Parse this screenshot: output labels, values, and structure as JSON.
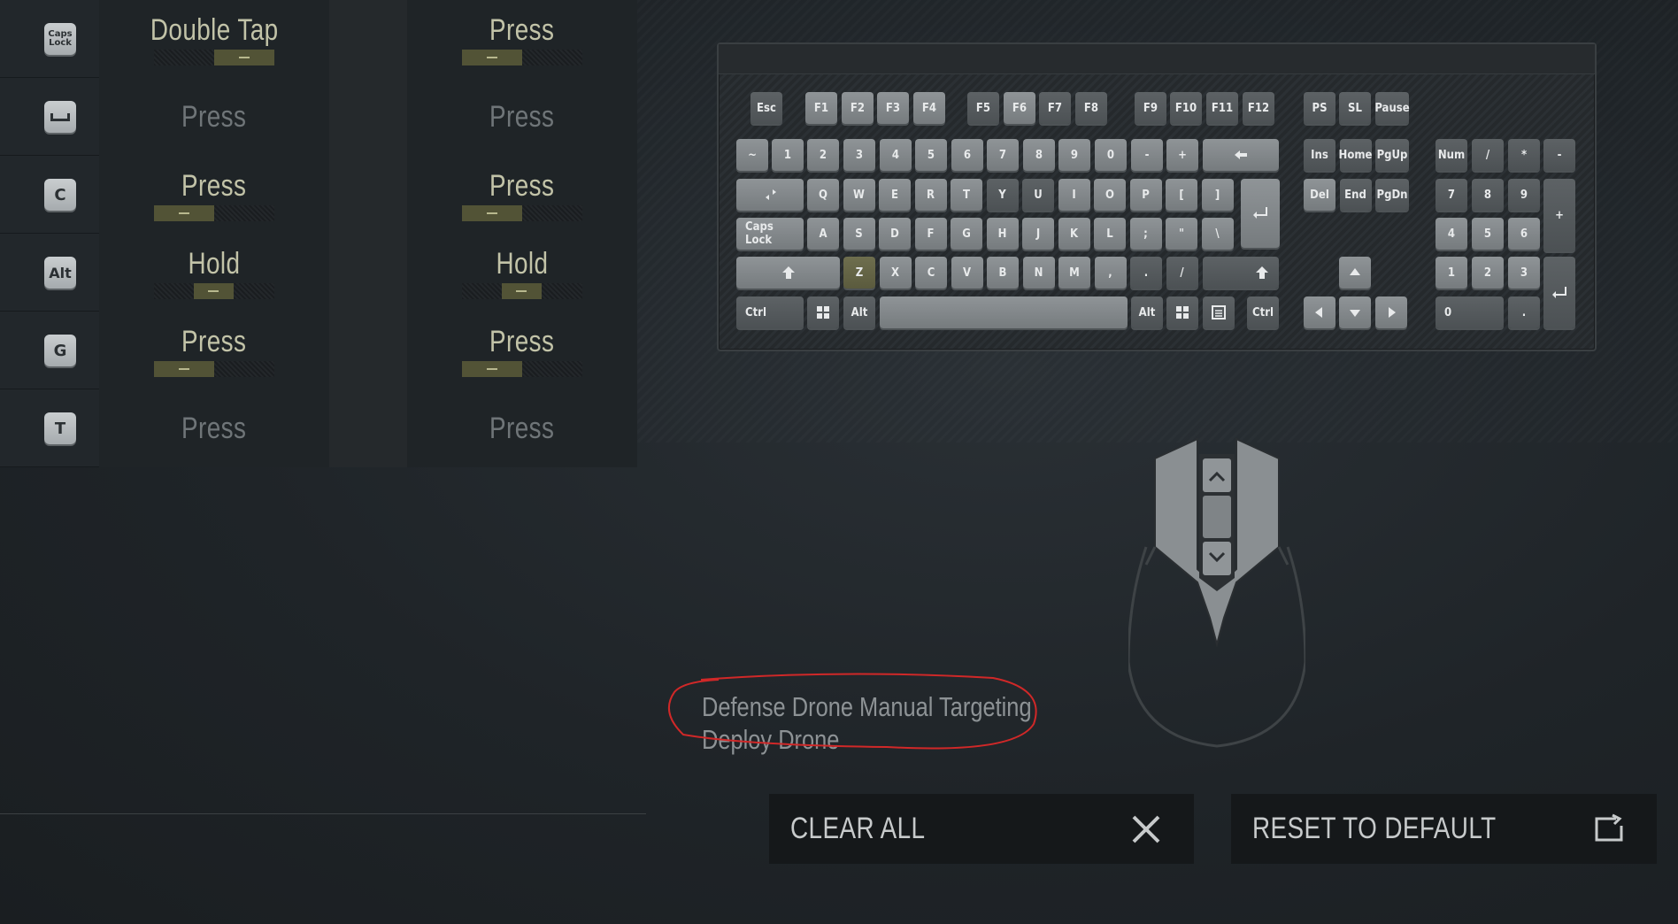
{
  "bindings": [
    {
      "key": "Caps Lock",
      "key_icon": "caps-lock-key",
      "primary": "Double Tap",
      "primary_active": true,
      "primary_fill": 0.5,
      "secondary": "Press",
      "secondary_active": true,
      "secondary_fill": 0.5
    },
    {
      "key": "",
      "key_icon": "spacebar-key",
      "primary": "Press",
      "primary_active": false,
      "secondary": "Press",
      "secondary_active": false
    },
    {
      "key": "C",
      "key_icon": "c-key",
      "primary": "Press",
      "primary_active": true,
      "primary_fill": 0.5,
      "secondary": "Press",
      "secondary_active": true,
      "secondary_fill": 0.5
    },
    {
      "key": "Alt",
      "key_icon": "alt-key",
      "primary": "Hold",
      "primary_active": true,
      "primary_fill": 0.33,
      "secondary": "Hold",
      "secondary_active": true,
      "secondary_fill": 0.33
    },
    {
      "key": "G",
      "key_icon": "g-key",
      "primary": "Press",
      "primary_active": true,
      "primary_fill": 0.5,
      "secondary": "Press",
      "secondary_active": true,
      "secondary_fill": 0.5
    },
    {
      "key": "T",
      "key_icon": "t-key",
      "primary": "Press",
      "primary_active": false,
      "secondary": "Press",
      "secondary_active": false
    }
  ],
  "keyboard": {
    "fn_row": [
      "Esc",
      "F1",
      "F2",
      "F3",
      "F4",
      "F5",
      "F6",
      "F7",
      "F8",
      "F9",
      "F10",
      "F11",
      "F12",
      "PS",
      "SL",
      "Pause"
    ],
    "num_row": [
      "~",
      "1",
      "2",
      "3",
      "4",
      "5",
      "6",
      "7",
      "8",
      "9",
      "0",
      "-",
      "+"
    ],
    "q_row": [
      "Q",
      "W",
      "E",
      "R",
      "T",
      "Y",
      "U",
      "I",
      "O",
      "P",
      "[",
      "]"
    ],
    "a_row": [
      "Caps Lock",
      "A",
      "S",
      "D",
      "F",
      "G",
      "H",
      "J",
      "K",
      "L",
      ";",
      "\"",
      "\\"
    ],
    "z_row": [
      "Z",
      "X",
      "C",
      "V",
      "B",
      "N",
      "M",
      ",",
      ".",
      "/"
    ],
    "bottom_row": [
      "Ctrl",
      "Alt",
      "Alt",
      "Ctrl"
    ],
    "nav": [
      "Ins",
      "Home",
      "PgUp",
      "Del",
      "End",
      "PgDn"
    ],
    "numpad": [
      "Num",
      "/",
      "*",
      "-",
      "7",
      "8",
      "9",
      "+",
      "4",
      "5",
      "6",
      "1",
      "2",
      "3",
      "0",
      "."
    ],
    "bound_keys": [
      "Z"
    ]
  },
  "actions": [
    "Defense Drone Manual Targeting",
    "Deploy Drone"
  ],
  "buttons": {
    "clear_all": "CLEAR ALL",
    "reset_default": "RESET TO DEFAULT"
  },
  "colors": {
    "active_text": "#c2c3a8",
    "inactive_text": "#6f7578",
    "meter_fill": "#525336",
    "annotation": "#d02828"
  }
}
